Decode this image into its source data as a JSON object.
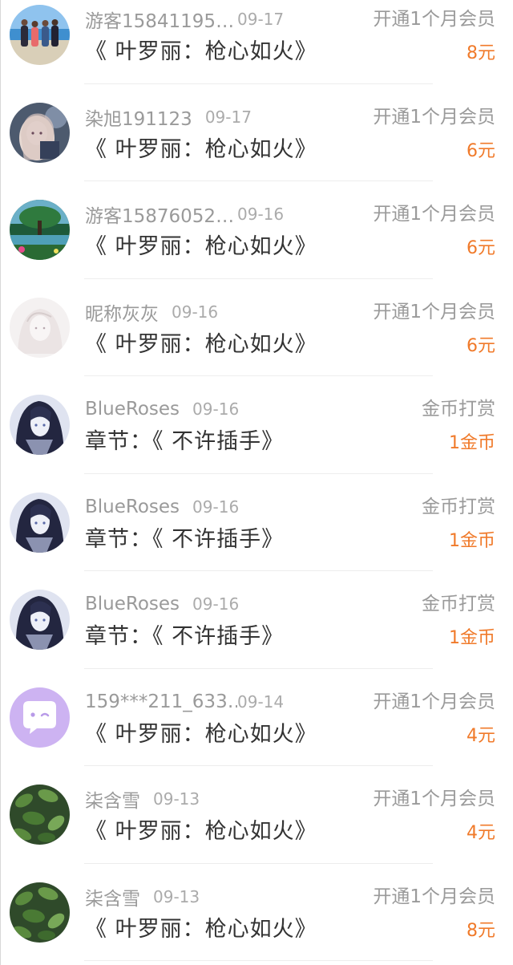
{
  "colors": {
    "amount": "#f07a2a",
    "name": "#9a9a9a",
    "title": "#333333",
    "divider": "#ededed"
  },
  "records": [
    {
      "avatar": "beach-group-photo-avatar",
      "name": "游客15841195…",
      "date": "09-17",
      "type": "开通1个月会员",
      "title": "《 叶罗丽：枪心如火》",
      "amount": "8元"
    },
    {
      "avatar": "anime-girl-avatar",
      "name": "染旭191123",
      "date": "09-17",
      "type": "开通1个月会员",
      "title": "《 叶罗丽：枪心如火》",
      "amount": "6元"
    },
    {
      "avatar": "landscape-tree-avatar",
      "name": "游客15876052…",
      "date": "09-16",
      "type": "开通1个月会员",
      "title": "《 叶罗丽：枪心如火》",
      "amount": "6元"
    },
    {
      "avatar": "pale-sketch-avatar",
      "name": "昵称灰灰",
      "date": "09-16",
      "type": "开通1个月会员",
      "title": "《 叶罗丽：枪心如火》",
      "amount": "6元"
    },
    {
      "avatar": "dark-anime-girl-avatar",
      "name": "BlueRoses",
      "date": "09-16",
      "type": "金币打赏",
      "title": "章节：《 不许插手》",
      "amount": "1金币"
    },
    {
      "avatar": "dark-anime-girl-avatar",
      "name": "BlueRoses",
      "date": "09-16",
      "type": "金币打赏",
      "title": "章节：《 不许插手》",
      "amount": "1金币"
    },
    {
      "avatar": "dark-anime-girl-avatar",
      "name": "BlueRoses",
      "date": "09-16",
      "type": "金币打赏",
      "title": "章节：《 不许插手》",
      "amount": "1金币"
    },
    {
      "avatar": "purple-chat-bubble-avatar",
      "name": "159***211_633…",
      "date": "09-14",
      "type": "开通1个月会员",
      "title": "《 叶罗丽：枪心如火》",
      "amount": "4元"
    },
    {
      "avatar": "green-leaves-avatar",
      "name": "柒含雪",
      "date": "09-13",
      "type": "开通1个月会员",
      "title": "《 叶罗丽：枪心如火》",
      "amount": "4元"
    },
    {
      "avatar": "green-leaves-avatar",
      "name": "柒含雪",
      "date": "09-13",
      "type": "开通1个月会员",
      "title": "《 叶罗丽：枪心如火》",
      "amount": "8元"
    }
  ]
}
